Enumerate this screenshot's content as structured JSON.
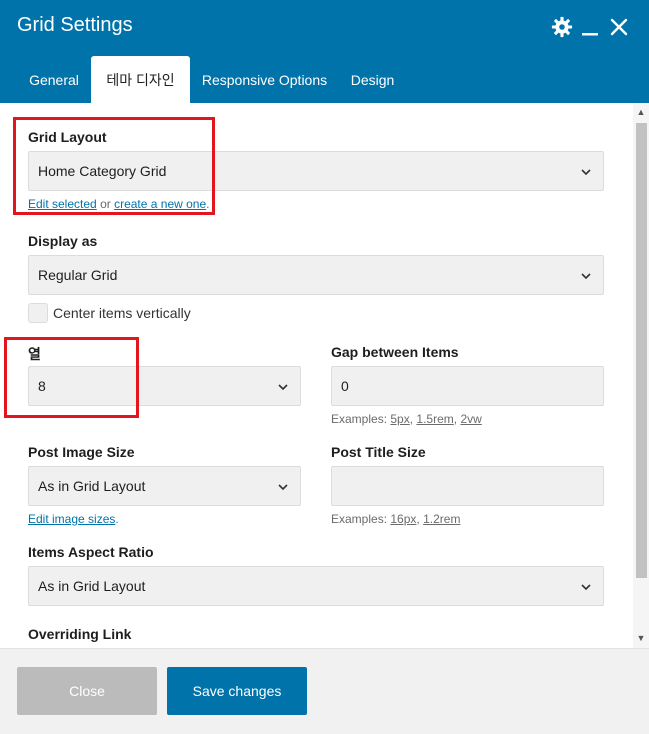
{
  "window": {
    "title": "Grid Settings"
  },
  "tabs": [
    {
      "label": "General"
    },
    {
      "label": "테마 디자인"
    },
    {
      "label": "Responsive Options"
    },
    {
      "label": "Design"
    }
  ],
  "grid_layout": {
    "label": "Grid Layout",
    "value": "Home Category Grid",
    "edit_link": "Edit selected",
    "or_text": "or",
    "create_link": "create a new one",
    "suffix": "."
  },
  "display_as": {
    "label": "Display as",
    "value": "Regular Grid",
    "center_label": "Center items vertically"
  },
  "columns": {
    "label": "열",
    "value": "8"
  },
  "gap": {
    "label": "Gap between Items",
    "value": "0",
    "examples_prefix": "Examples:",
    "ex1": "5px",
    "ex2": "1.5rem",
    "ex3": "2vw",
    "sep": ","
  },
  "post_image_size": {
    "label": "Post Image Size",
    "value": "As in Grid Layout",
    "link": "Edit image sizes",
    "suffix": "."
  },
  "post_title_size": {
    "label": "Post Title Size",
    "value": "",
    "examples_prefix": "Examples:",
    "ex1": "16px",
    "ex2": "1.2rem",
    "sep": ","
  },
  "aspect_ratio": {
    "label": "Items Aspect Ratio",
    "value": "As in Grid Layout"
  },
  "overriding_link": {
    "label": "Overriding Link"
  },
  "footer": {
    "close_label": "Close",
    "save_label": "Save changes"
  },
  "colors": {
    "brand": "#0073aa",
    "highlight": "#e2161e",
    "disabled": "#bbbbbb"
  },
  "icons": {
    "settings": "gear-icon",
    "minimize": "minimize-icon",
    "close": "close-icon",
    "select": "chevron-down-icon"
  }
}
